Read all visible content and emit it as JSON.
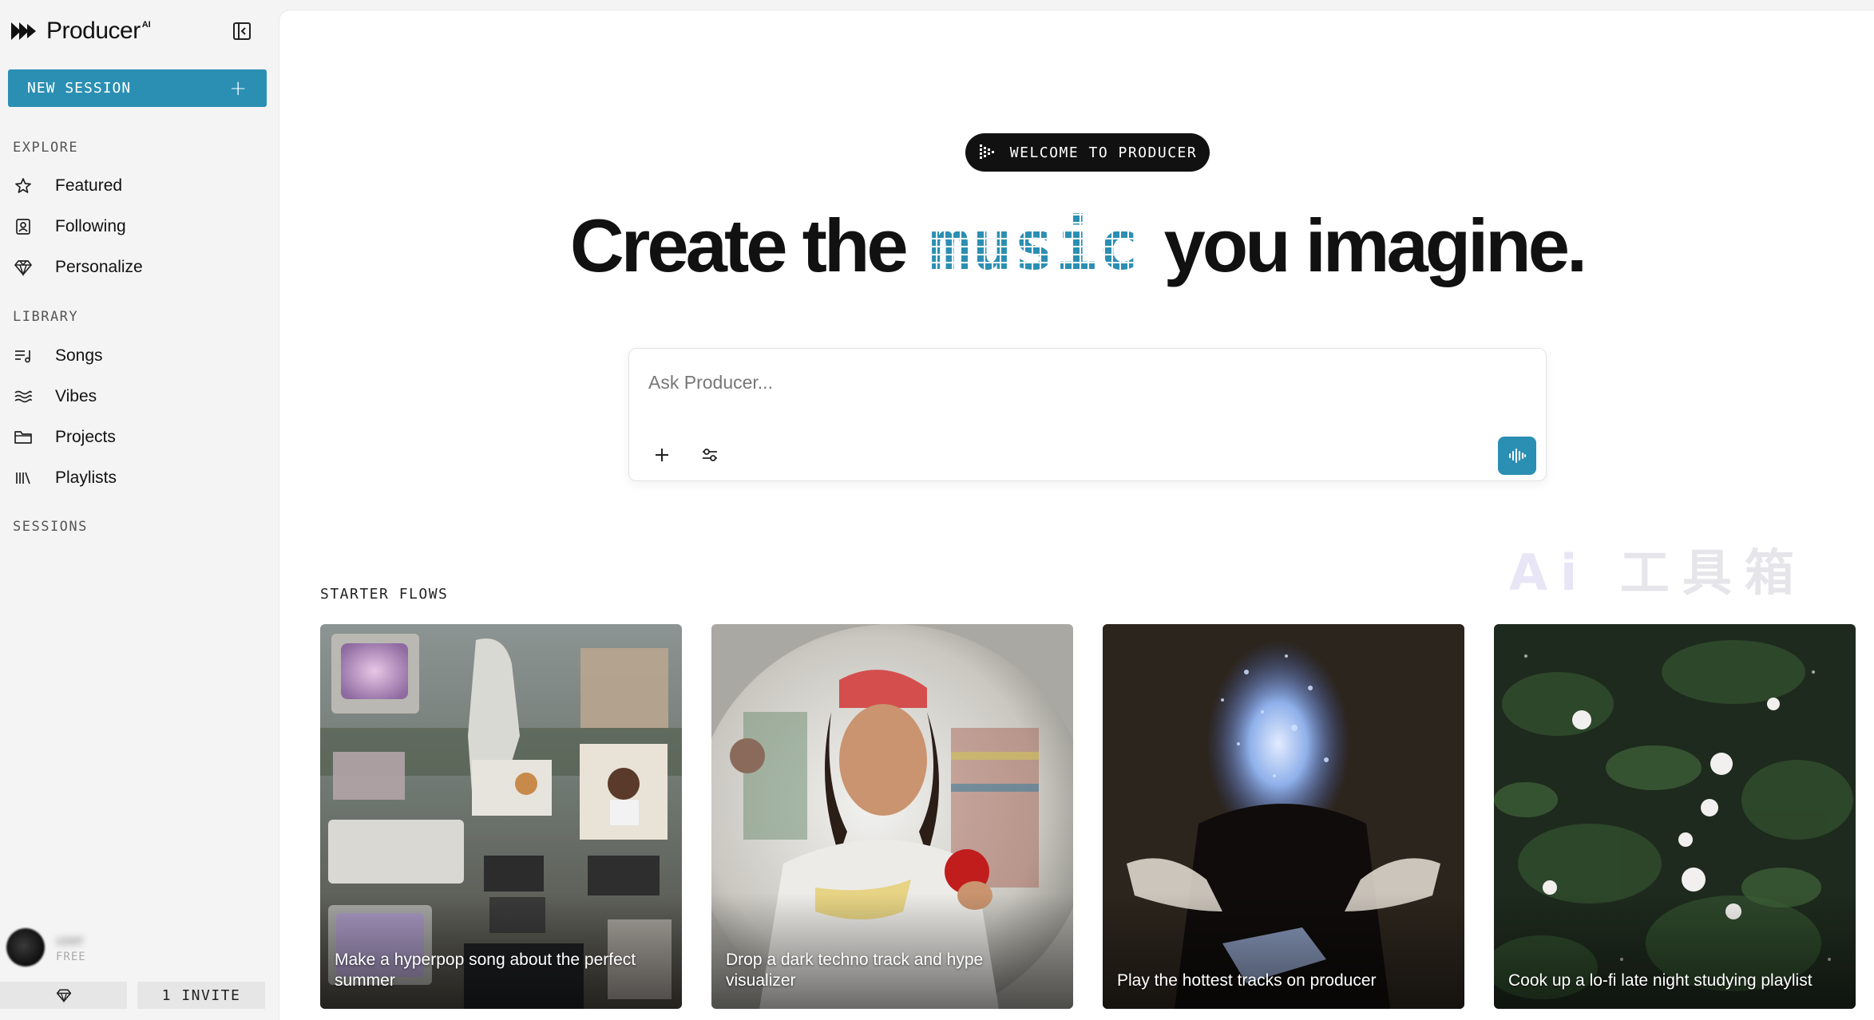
{
  "app": {
    "name": "Producer",
    "name_sup": "AI"
  },
  "sidebar": {
    "new_session_label": "NEW SESSION",
    "new_session_plus": "+",
    "explore_label": "EXPLORE",
    "explore_items": [
      {
        "label": "Featured",
        "icon": "star-icon"
      },
      {
        "label": "Following",
        "icon": "following-icon"
      },
      {
        "label": "Personalize",
        "icon": "diamond-icon"
      }
    ],
    "library_label": "LIBRARY",
    "library_items": [
      {
        "label": "Songs",
        "icon": "songs-icon"
      },
      {
        "label": "Vibes",
        "icon": "vibes-icon"
      },
      {
        "label": "Projects",
        "icon": "folder-icon"
      },
      {
        "label": "Playlists",
        "icon": "playlists-icon"
      }
    ],
    "sessions_label": "SESSIONS",
    "user": {
      "name": "user",
      "plan": "FREE"
    },
    "invite_label": "1 INVITE"
  },
  "main": {
    "welcome_badge": "WELCOME TO PRODUCER",
    "headline": {
      "before": "Create the",
      "highlight": "music",
      "after": "you imagine."
    },
    "prompt": {
      "placeholder": "Ask Producer...",
      "value": ""
    },
    "watermark": {
      "ai": "Ai",
      "rest": "工具箱"
    },
    "starter_flows_label": "STARTER FLOWS",
    "starter_flows": [
      {
        "caption": "Make a hyperpop song about the perfect summer"
      },
      {
        "caption": "Drop a dark techno track and hype visualizer"
      },
      {
        "caption": "Play the hottest tracks on producer"
      },
      {
        "caption": "Cook up a lo-fi late night studying playlist"
      }
    ]
  },
  "colors": {
    "accent": "#2b8fb3",
    "sidebar_bg": "#f4f4f4",
    "main_bg": "#ffffff",
    "badge_bg": "#111111"
  }
}
